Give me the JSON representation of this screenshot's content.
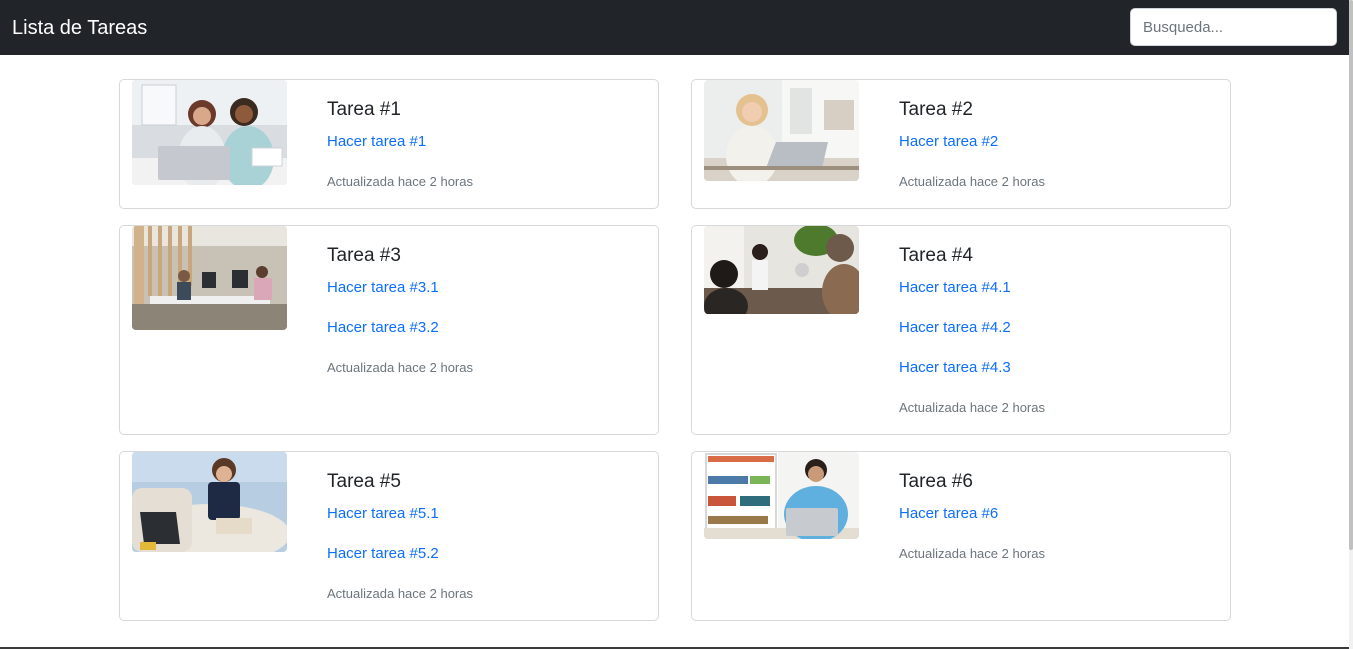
{
  "navbar": {
    "brand": "Lista de Tareas",
    "search_placeholder": "Busqueda..."
  },
  "cards": [
    {
      "title": "Tarea #1",
      "links": [
        "Hacer tarea #1"
      ],
      "updated": "Actualizada hace 2 horas",
      "image": "two women looking at a laptop in an office"
    },
    {
      "title": "Tarea #2",
      "links": [
        "Hacer tarea #2"
      ],
      "updated": "Actualizada hace 2 horas",
      "image": "woman working on a laptop at a desk"
    },
    {
      "title": "Tarea #3",
      "links": [
        "Hacer tarea #3.1",
        "Hacer tarea #3.2"
      ],
      "updated": "Actualizada hace 2 horas",
      "image": "open plan office with people at computers"
    },
    {
      "title": "Tarea #4",
      "links": [
        "Hacer tarea #4.1",
        "Hacer tarea #4.2",
        "Hacer tarea #4.3"
      ],
      "updated": "Actualizada hace 2 horas",
      "image": "team meeting with presenter"
    },
    {
      "title": "Tarea #5",
      "links": [
        "Hacer tarea #5.1",
        "Hacer tarea #5.2"
      ],
      "updated": "Actualizada hace 2 horas",
      "image": "woman on the phone with a laptop on a sofa"
    },
    {
      "title": "Tarea #6",
      "links": [
        "Hacer tarea #6"
      ],
      "updated": "Actualizada hace 2 horas",
      "image": "man working on a laptop in front of a bookshelf"
    }
  ]
}
